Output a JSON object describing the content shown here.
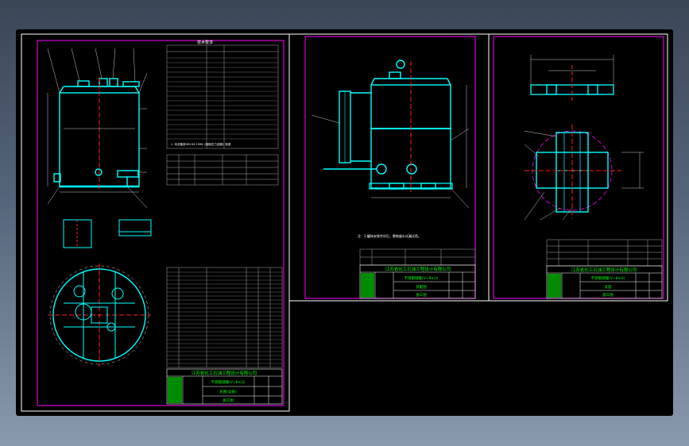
{
  "sheets": {
    "sheet1": {
      "title_block": {
        "company": "江苏省化工石油工程设计有限公司",
        "drawing_name": "不锈钢储罐(V=6m3)",
        "sub_name": "总图(设备)",
        "stage": "施工图"
      },
      "tech_heading": "技术要求",
      "note_line": "1. 本设备按GB150-1998《钢制压力容器》制造"
    },
    "sheet2": {
      "title_block": {
        "company": "江苏省化工石油工程设计有限公司",
        "drawing_name": "不锈钢储罐(V=6m3)",
        "sub_name": "装配图",
        "stage": "施工图"
      },
      "note": "注：1.罐体安装完毕后，需做盛水试漏试验。"
    },
    "sheet3": {
      "title_block": {
        "company": "江苏省化工石油工程设计有限公司",
        "drawing_name": "不锈钢储罐(V=6m3)",
        "sub_name": "支座",
        "stage": "施工图"
      }
    }
  },
  "colors": {
    "background": "#000000",
    "frame": "#ff00ff",
    "sheet_border": "#ffffff",
    "equipment": "#00ffff",
    "centerline": "#ff2020",
    "title_block_text": "#00ff00",
    "annotation": "#ffffff"
  }
}
